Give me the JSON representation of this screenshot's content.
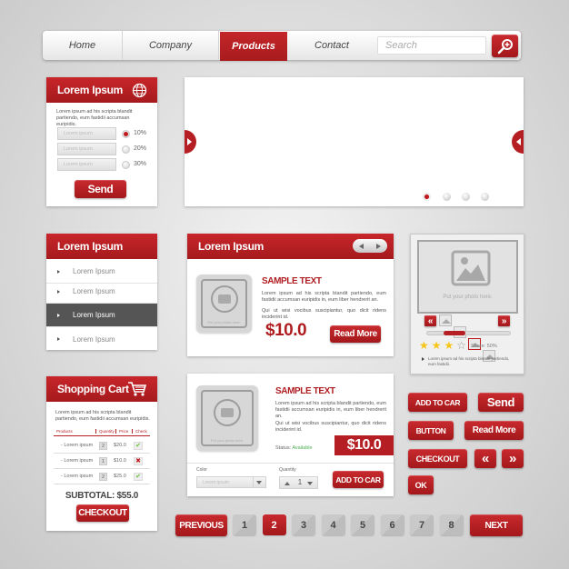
{
  "nav": {
    "items": [
      "Home",
      "Company",
      "Products",
      "Contact"
    ],
    "active_index": 2,
    "search_placeholder": "Search",
    "search_icon": "magnifier-plus-icon"
  },
  "form_card": {
    "title": "Lorem Ipsum",
    "icon": "globe-icon",
    "description": "Lorem ipsum ad his scripta blandit partiendo, eum fastidii accumsan euripidis.",
    "fields": [
      {
        "placeholder": "Lorem ipsum",
        "option": "10%",
        "selected": true
      },
      {
        "placeholder": "Lorem ipsum",
        "option": "20%",
        "selected": false
      },
      {
        "placeholder": "Lorem ipsum",
        "option": "30%",
        "selected": false
      }
    ],
    "send_label": "Send"
  },
  "slider": {
    "dots": 4,
    "active_dot": 0
  },
  "menu_list": {
    "title": "Lorem Ipsum",
    "items": [
      "Lorem Ipsum",
      "Lorem Ipsum",
      "Lorem Ipsum",
      "Lorem Ipsum"
    ],
    "active_index": 2
  },
  "product_card": {
    "title": "Lorem Ipsum",
    "photo_caption": "Put your photo here.",
    "heading": "SAMPLE TEXT",
    "text1": "Lorem ipsum ad his scripta blandit partiendo, eum fastidii accumsan euripidis in, eum liber hendrerit an.",
    "text2": "Qui ut wisi vocibus suscipiantur, quo dicit ridens inciderint id.",
    "price": "$10.0",
    "button_label": "Read More"
  },
  "gallery": {
    "photo_caption": "Put your photo here.",
    "thumbnails": 5,
    "selected_thumb": 3,
    "progress": 0.35,
    "rating": 3,
    "rating_max": 4,
    "share_label": "Share: 50%",
    "note": "Lorem ipsum ad his scripta blandit partiendo, eum fastidii."
  },
  "cart": {
    "title": "Shopping Cart",
    "description": "Lorem ipsum ad his scripta blandit partiendo, eum fastidii accumsan euripidis.",
    "columns": [
      "Products",
      "Quantity",
      "Price",
      "Check"
    ],
    "rows": [
      {
        "product": "- Lorem ipsum",
        "qty": "2",
        "price": "$20.0",
        "check": "✔",
        "ok": true
      },
      {
        "product": "- Lorem ipsum",
        "qty": "1",
        "price": "$10.0",
        "check": "✖",
        "ok": false
      },
      {
        "product": "- Lorem ipsum",
        "qty": "2",
        "price": "$25.0",
        "check": "✔",
        "ok": true
      }
    ],
    "subtotal": "SUBTOTAL: $55.0",
    "checkout_label": "CHECKOUT"
  },
  "detail_card": {
    "photo_caption": "Put your photo here.",
    "heading": "SAMPLE TEXT",
    "text1": "Lorem ipsum ad his scripta blandit partiendo, eum fastidii accumsan euripidis in, eum liber hendrerit an.",
    "text2": "Qui ut wisi vocibus suscipiantur, quo dicit ridens inciderint id.",
    "status_label": "Status:",
    "status_value": "Available",
    "price": "$10.0",
    "color_label": "Color",
    "color_value": "Lorem ipsum",
    "quantity_label": "Quantity",
    "quantity_value": "1",
    "add_label": "ADD TO CAR"
  },
  "buttons": {
    "add_to_cart": "ADD TO CAR",
    "send": "Send",
    "button": "BUTTON",
    "read_more": "Read More",
    "checkout": "CHECKOUT",
    "prev_glyph": "«",
    "next_glyph": "»",
    "ok": "OK"
  },
  "pagination": {
    "previous": "PREVIOUS",
    "pages": [
      "1",
      "2",
      "3",
      "4",
      "5",
      "6",
      "7",
      "8"
    ],
    "active": "2",
    "next": "NEXT"
  },
  "colors": {
    "accent": "#b51f23",
    "dark_item": "#555555",
    "available": "#4caf50",
    "star": "#f5c518"
  }
}
